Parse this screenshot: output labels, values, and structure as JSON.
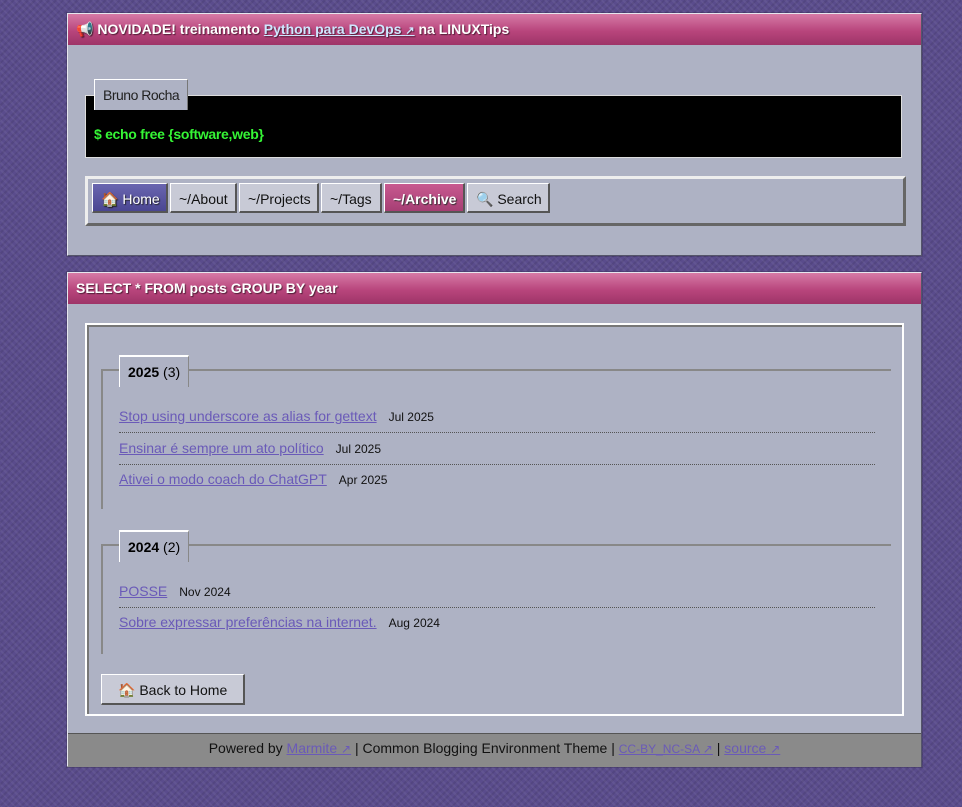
{
  "announcement": {
    "icon": "megaphone-icon",
    "prefix": "NOVIDADE! treinamento",
    "link_label": "Python para DevOps",
    "link_suffix": "↗",
    "suffix": "na LINUXTips"
  },
  "site": {
    "author_name": "Bruno Rocha",
    "terminal_command": "$ echo free {software,web}"
  },
  "nav": {
    "home_icon": "🏠",
    "home": "Home",
    "about": "~/About",
    "projects": "~/Projects",
    "tags": "~/Tags",
    "archive": "~/Archive",
    "search_icon": "🔍",
    "search": "Search"
  },
  "archive": {
    "title": "SELECT * FROM posts GROUP BY year",
    "groups": [
      {
        "year": "2025",
        "count": "(3)",
        "posts": [
          {
            "title": "Stop using underscore as alias for gettext",
            "date": "Jul 2025"
          },
          {
            "title": "Ensinar é sempre um ato político",
            "date": "Jul 2025"
          },
          {
            "title": "Ativei o modo coach do ChatGPT",
            "date": "Apr 2025"
          }
        ]
      },
      {
        "year": "2024",
        "count": "(2)",
        "posts": [
          {
            "title": "POSSE",
            "date": "Nov 2024"
          },
          {
            "title": "Sobre expressar preferências na internet.",
            "date": "Aug 2024"
          }
        ]
      }
    ],
    "back_icon": "🏠",
    "back_label": "Back to Home"
  },
  "footer": {
    "powered_by": "Powered by",
    "marmite": "Marmite",
    "arrow": "↗",
    "theme": "| Common Blogging Environment Theme |",
    "license": "CC-BY_NC-SA",
    "sep": "|",
    "source": "source"
  }
}
